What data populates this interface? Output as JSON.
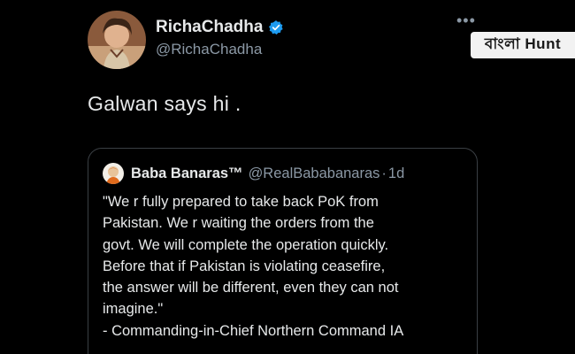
{
  "author": {
    "name": "RichaChadha",
    "handle": "@RichaChadha",
    "avatar_icon": "user-avatar-photo",
    "verified_icon": "verified-badge-icon"
  },
  "tweet": {
    "text": "Galwan says hi ."
  },
  "menu": {
    "more_label": "•••"
  },
  "watermark": {
    "text": "বাংলা Hunt"
  },
  "quote": {
    "author_name": "Baba Banaras™",
    "author_handle": "@RealBababanaras",
    "separator": "·",
    "time": "1d",
    "lines": [
      "\"We r fully prepared to take back PoK from",
      "Pakistan. We r waiting the orders from the",
      "govt. We will complete the operation quickly.",
      "Before that if Pakistan is violating ceasefire,",
      "the answer will be different, even they can not",
      "imagine.\"",
      "- Commanding-in-Chief Northern Command IA"
    ]
  },
  "colors": {
    "background": "#000000",
    "text_primary": "#e7e9ea",
    "text_secondary": "#8b98a5",
    "verified_blue": "#1d9bf0",
    "card_border": "#3a3f44"
  }
}
